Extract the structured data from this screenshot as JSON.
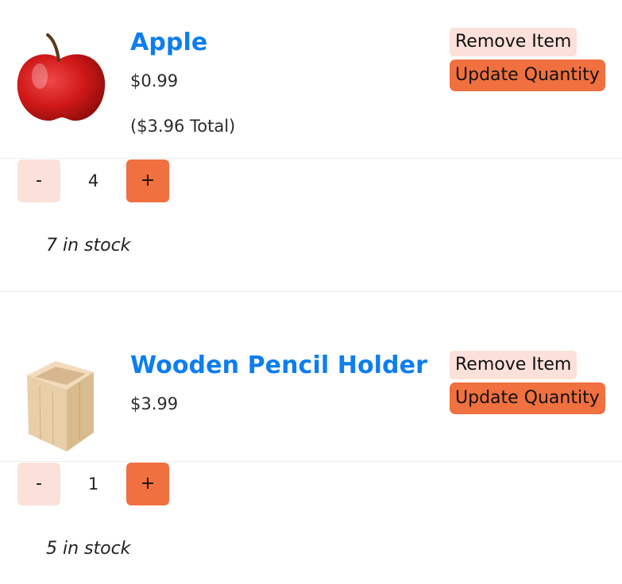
{
  "cart": {
    "items": [
      {
        "name": "Apple",
        "price": "$0.99",
        "total": "($3.96 Total)",
        "remove_label": "Remove Item",
        "update_label": "Update Quantity",
        "minus_label": "-",
        "plus_label": "+",
        "quantity": "4",
        "stock": "7 in stock"
      },
      {
        "name": "Wooden Pencil Holder",
        "price": "$3.99",
        "remove_label": "Remove Item",
        "update_label": "Update Quantity",
        "minus_label": "-",
        "plus_label": "+",
        "quantity": "1",
        "stock": "5 in stock"
      }
    ]
  },
  "colors": {
    "product_link": "#0d7df0",
    "accent_orange": "#f0703f",
    "accent_light": "#fbe1da"
  }
}
